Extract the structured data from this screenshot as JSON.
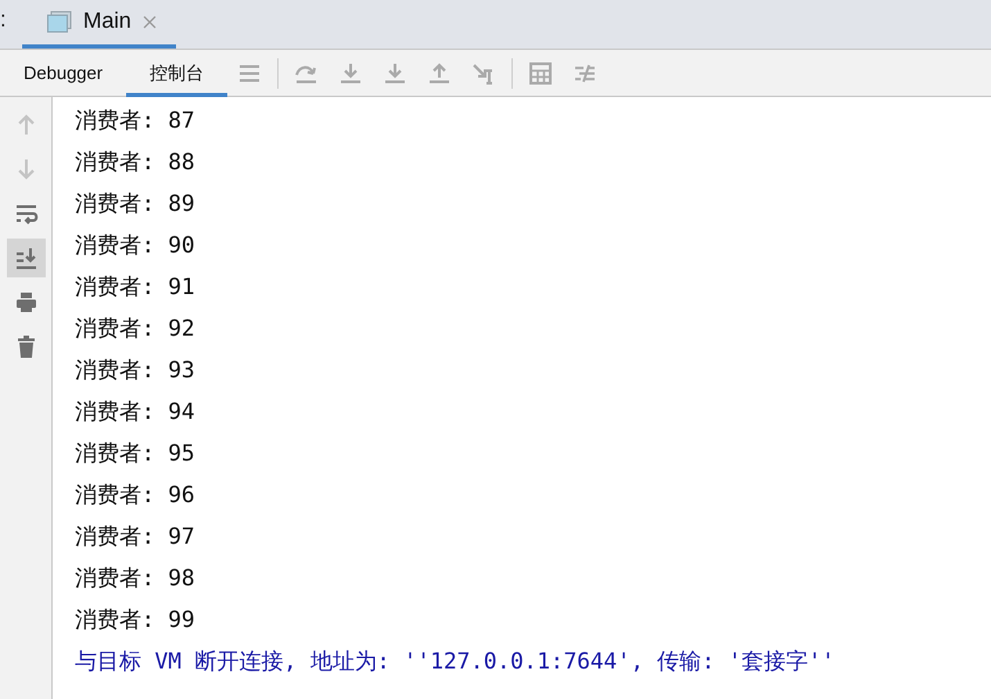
{
  "title_fragment": ":",
  "editor_tabs": [
    {
      "label": "Main",
      "selected": true
    }
  ],
  "tool_tabs": [
    {
      "label": "Debugger",
      "selected": false
    },
    {
      "label": "控制台",
      "selected": true
    }
  ],
  "toolbar_buttons": [
    {
      "kind": "menu"
    },
    {
      "kind": "step-over"
    },
    {
      "kind": "step-into"
    },
    {
      "kind": "force-step-into"
    },
    {
      "kind": "step-out"
    },
    {
      "kind": "run-to-cursor"
    },
    {
      "kind": "calculator"
    },
    {
      "kind": "trace"
    }
  ],
  "gutter_buttons": [
    {
      "kind": "up",
      "on": false,
      "disabled": true
    },
    {
      "kind": "down",
      "on": false,
      "disabled": true
    },
    {
      "kind": "wrap",
      "on": false,
      "disabled": false
    },
    {
      "kind": "scroll-end",
      "on": true,
      "disabled": false
    },
    {
      "kind": "print",
      "on": false,
      "disabled": false
    },
    {
      "kind": "trash",
      "on": false,
      "disabled": false
    }
  ],
  "console_lines": [
    {
      "kind": "output",
      "text": "消费者: 87"
    },
    {
      "kind": "output",
      "text": "消费者: 88"
    },
    {
      "kind": "output",
      "text": "消费者: 89"
    },
    {
      "kind": "output",
      "text": "消费者: 90"
    },
    {
      "kind": "output",
      "text": "消费者: 91"
    },
    {
      "kind": "output",
      "text": "消费者: 92"
    },
    {
      "kind": "output",
      "text": "消费者: 93"
    },
    {
      "kind": "output",
      "text": "消费者: 94"
    },
    {
      "kind": "output",
      "text": "消费者: 95"
    },
    {
      "kind": "output",
      "text": "消费者: 96"
    },
    {
      "kind": "output",
      "text": "消费者: 97"
    },
    {
      "kind": "output",
      "text": "消费者: 98"
    },
    {
      "kind": "output",
      "text": "消费者: 99"
    },
    {
      "kind": "system",
      "text": "与目标 VM 断开连接, 地址为: ''127.0.0.1:7644', 传输: '套接字''"
    }
  ]
}
